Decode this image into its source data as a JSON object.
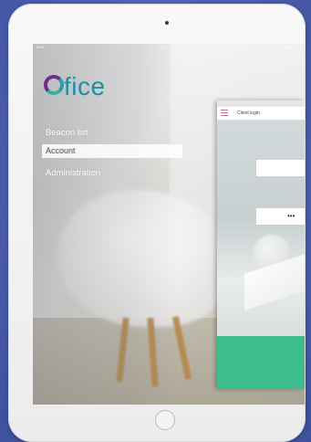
{
  "app": {
    "logo_text": "fice",
    "logo_colors": {
      "ring_primary": "#6b2f8f",
      "ring_secondary": "#2b9bb0",
      "text": "#1f8ea3"
    }
  },
  "status_bar": {
    "left": "iPad",
    "center": "9:41",
    "right": "100%"
  },
  "menu": {
    "items": [
      {
        "label": "Beacon list",
        "selected": false
      },
      {
        "label": "Account",
        "selected": true
      },
      {
        "label": "Administration",
        "selected": false
      }
    ]
  },
  "login_panel": {
    "title": "Client login",
    "username_value": "",
    "password_value": "•••",
    "button_color": "#3dbd8e",
    "menu_icon": "hamburger-icon"
  },
  "colors": {
    "page_background": "#4f62b0",
    "device_bezel": "#f4f4f4"
  }
}
